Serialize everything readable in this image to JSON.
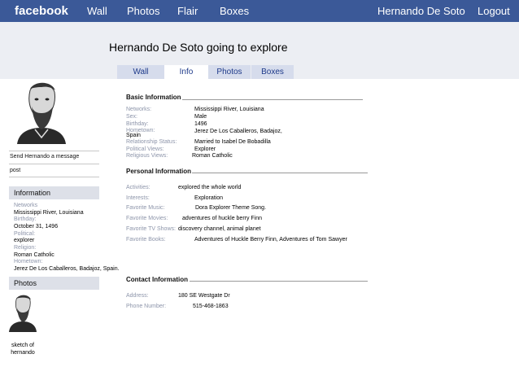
{
  "topbar": {
    "brand": "facebook",
    "nav": [
      "Wall",
      "Photos",
      "Flair",
      "Boxes"
    ],
    "user": "Hernando De Soto",
    "logout": "Logout"
  },
  "profile": {
    "title": "Hernando De Soto going to explore"
  },
  "tabs": [
    {
      "label": "Wall",
      "active": false
    },
    {
      "label": "Info",
      "active": true
    },
    {
      "label": "Photos",
      "active": false
    },
    {
      "label": "Boxes",
      "active": false
    }
  ],
  "sidebar": {
    "send_message": "Send Hernando a message",
    "post": "post",
    "info_header": "Information",
    "info": [
      {
        "label": "Networks",
        "value": "Mississippi River, Louisiana"
      },
      {
        "label": "Birthday:",
        "value": "October 31, 1496"
      },
      {
        "label": "Political:",
        "value": "explorer"
      },
      {
        "label": "Religion:",
        "value": "Roman Catholic"
      },
      {
        "label": "Hometown:",
        "value": "Jerez De Los Caballeros, Badajoz, Spain."
      }
    ],
    "photos_header": "Photos",
    "photo_caption_1": "sketch of",
    "photo_caption_2": "hernando"
  },
  "basic": {
    "title": "Basic Information",
    "rows": [
      {
        "label": "Networks:",
        "value": "Mississippi River, Louisiana"
      },
      {
        "label": "Sex:",
        "value": "Male"
      },
      {
        "label": "Birthday:",
        "value": "1496"
      },
      {
        "label": "Hometown:",
        "value": "Jerez De Los Caballeros, Badajoz,"
      },
      {
        "label": "Relationship Status:",
        "value": "Married to Isabel De Bobadilla"
      },
      {
        "label": "Political Views:",
        "value": "Explorer"
      },
      {
        "label": "Religious Views:",
        "value": "Roman  Catholic"
      }
    ],
    "hometown_extra": "Spain"
  },
  "personal": {
    "title": "Personal Information",
    "rows": [
      {
        "label": "Activities:",
        "value": "explored the whole world"
      },
      {
        "label": "Interests:",
        "value": "Exploration"
      },
      {
        "label": "Favorite Music:",
        "value": "Dora Explorer Theme Song."
      },
      {
        "label": "Favorite Movies:",
        "value": "adventures of huckle berry Finn"
      },
      {
        "label": "Favorite TV Shows:",
        "value": "discovery channel, animal planet"
      },
      {
        "label": "Favorite Books:",
        "value": "Adventures of Huckle Berry Finn, Adventures of Tom Sawyer"
      }
    ]
  },
  "contact": {
    "title": "Contact Information",
    "rows": [
      {
        "label": "Address:",
        "value": "180 SE Westgate Dr"
      },
      {
        "label": "Phone Number:",
        "value": "515-468-1863"
      }
    ]
  },
  "colors": {
    "topbar": "#3b5998",
    "band": "#eceef3",
    "tab": "#d6dcec",
    "label": "#8d95aa"
  }
}
